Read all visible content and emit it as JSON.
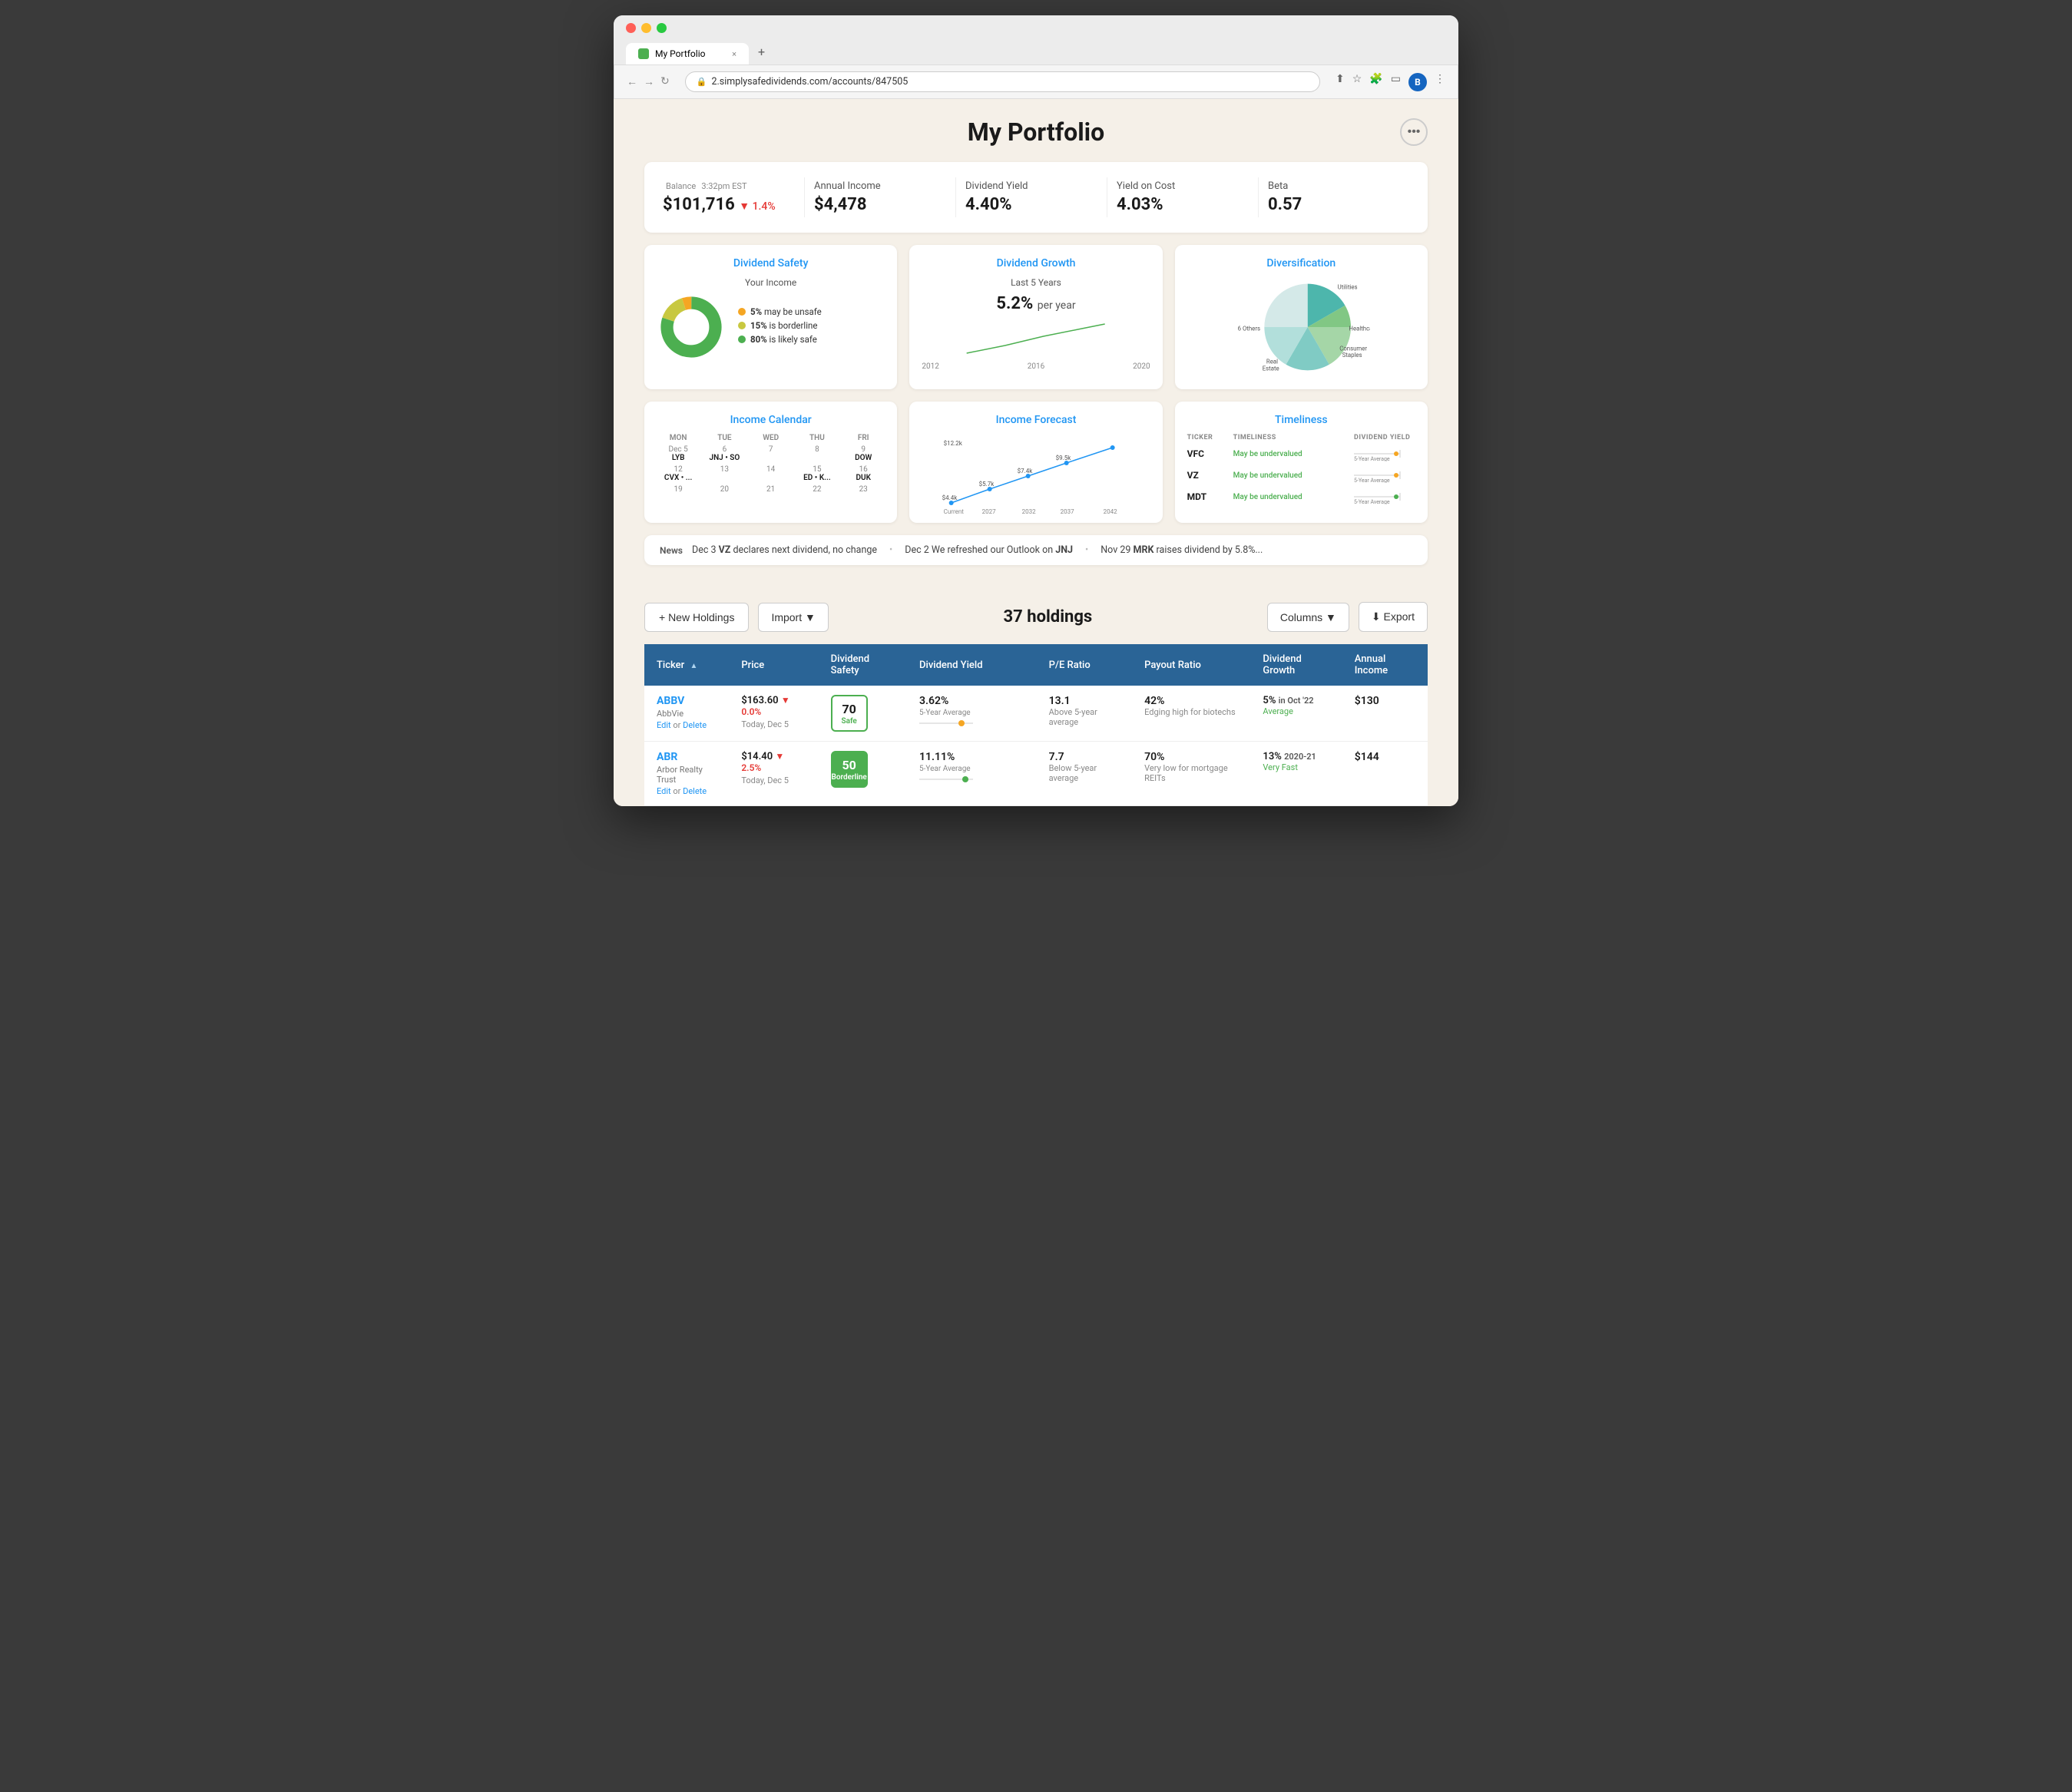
{
  "browser": {
    "tab_title": "My Portfolio",
    "tab_close": "×",
    "tab_new": "+",
    "url": "2.simplysafedividends.com/accounts/847505",
    "nav_back": "←",
    "nav_forward": "→",
    "nav_refresh": "↻"
  },
  "page": {
    "title": "My Portfolio",
    "more_button": "•••"
  },
  "summary": {
    "balance_label": "Balance",
    "balance_time": "3:32pm EST",
    "balance_value": "$101,716",
    "balance_change": "▼ 1.4%",
    "annual_income_label": "Annual Income",
    "annual_income_value": "$4,478",
    "dividend_yield_label": "Dividend Yield",
    "dividend_yield_value": "4.40%",
    "yield_on_cost_label": "Yield on Cost",
    "yield_on_cost_value": "4.03%",
    "beta_label": "Beta",
    "beta_value": "0.57"
  },
  "widgets": {
    "dividend_safety": {
      "title": "Dividend Safety",
      "subtitle": "Your Income",
      "legend": [
        {
          "color": "#f5a623",
          "pct": "5%",
          "text": "may be unsafe"
        },
        {
          "color": "#c8c840",
          "pct": "15%",
          "text": "is borderline"
        },
        {
          "color": "#4CAF50",
          "pct": "80%",
          "text": "is likely safe"
        }
      ]
    },
    "dividend_growth": {
      "title": "Dividend Growth",
      "subtitle": "Last 5 Years",
      "value": "5.2%",
      "unit": "per year",
      "chart_labels": [
        "2012",
        "2016",
        "2020"
      ]
    },
    "diversification": {
      "title": "Diversification",
      "labels": [
        "Utilities",
        "Healthcare",
        "Consumer Staples",
        "Real Estate",
        "6 Others"
      ]
    },
    "income_calendar": {
      "title": "Income Calendar",
      "days": [
        "MON",
        "TUE",
        "WED",
        "THU",
        "FRI"
      ],
      "rows": [
        {
          "dates": [
            "Dec 5",
            "6",
            "7",
            "8",
            "9"
          ],
          "tickers": [
            "LYB",
            "JNJ • SO",
            "",
            "",
            "DOW"
          ]
        },
        {
          "dates": [
            "12",
            "13",
            "14",
            "15",
            "16"
          ],
          "tickers": [
            "CVX • ...",
            "",
            "",
            "ED • K...",
            "DUK"
          ]
        },
        {
          "dates": [
            "19",
            "20",
            "21",
            "22",
            "23"
          ],
          "tickers": [
            "",
            "",
            "",
            "",
            ""
          ]
        }
      ]
    },
    "income_forecast": {
      "title": "Income Forecast",
      "points": [
        {
          "label": "Current",
          "value": "$4.4k"
        },
        {
          "label": "2027",
          "value": "$5.7k"
        },
        {
          "label": "2032",
          "value": "$7.4k"
        },
        {
          "label": "2037",
          "value": "$9.5k"
        },
        {
          "label": "2042",
          "value": "$12.2k"
        }
      ]
    },
    "timeliness": {
      "title": "Timeliness",
      "headers": [
        "TICKER",
        "TIMELINESS",
        "DIVIDEND YIELD"
      ],
      "rows": [
        {
          "ticker": "VFC",
          "status": "May be undervalued",
          "label": "5-Year Average"
        },
        {
          "ticker": "VZ",
          "status": "May be undervalued",
          "label": "5-Year Average"
        },
        {
          "ticker": "MDT",
          "status": "May be undervalued",
          "label": "5-Year Average"
        }
      ]
    }
  },
  "news": {
    "label": "News",
    "items": [
      {
        "date": "Dec 3",
        "ticker": "VZ",
        "text": "declares next dividend, no change"
      },
      {
        "date": "Dec 2",
        "text": "We refreshed our Outlook on",
        "ticker": "JNJ"
      },
      {
        "date": "Nov 29",
        "ticker": "MRK",
        "text": "raises dividend by 5.8%..."
      }
    ]
  },
  "holdings": {
    "new_button": "+ New Holdings",
    "import_button": "Import ▼",
    "count_label": "37 holdings",
    "columns_button": "Columns ▼",
    "export_button": "⬇ Export",
    "table_headers": [
      "Ticker",
      "Price",
      "Dividend Safety",
      "Dividend Yield",
      "P/E Ratio",
      "Payout Ratio",
      "Dividend Growth",
      "Annual Income"
    ],
    "rows": [
      {
        "ticker": "ABBV",
        "company": "AbbVie",
        "edit": "Edit",
        "delete": "Delete",
        "price": "$163.60",
        "price_change": "▼ 0.0%",
        "price_date": "Today, Dec 5",
        "safety_score": "70",
        "safety_label": "Safe",
        "safety_class": "safe",
        "div_yield": "3.62%",
        "div_yield_avg_label": "5-Year Average",
        "pe_ratio": "13.1",
        "pe_sub": "Above 5-year average",
        "payout": "42%",
        "payout_sub": "Edging high for biotechs",
        "dg_value": "5%",
        "dg_date": "in Oct '22",
        "dg_label": "Average",
        "income": "$130"
      },
      {
        "ticker": "ABR",
        "company": "Arbor Realty Trust",
        "edit": "Edit",
        "delete": "Delete",
        "price": "$14.40",
        "price_change": "▼ 2.5%",
        "price_date": "Today, Dec 5",
        "safety_score": "50",
        "safety_label": "Borderline",
        "safety_class": "borderline",
        "div_yield": "11.11%",
        "div_yield_avg_label": "5-Year Average",
        "pe_ratio": "7.7",
        "pe_sub": "Below 5-year average",
        "payout": "70%",
        "payout_sub": "Very low for mortgage REITs",
        "dg_value": "13%",
        "dg_date": "2020-21",
        "dg_label": "Very Fast",
        "income": "$144"
      }
    ]
  }
}
